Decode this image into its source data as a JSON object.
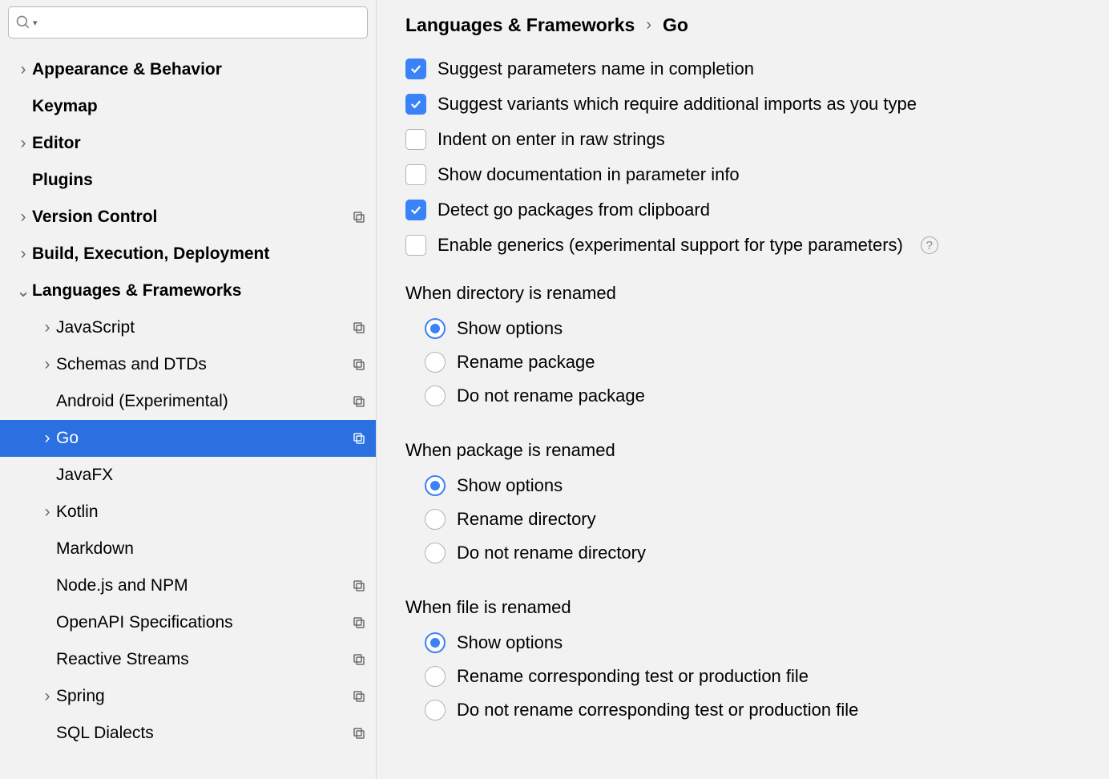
{
  "search": {
    "placeholder": ""
  },
  "sidebar": {
    "items": [
      {
        "label": "Appearance & Behavior",
        "bold": true,
        "depth": 0,
        "chevron": "right",
        "profile": false,
        "selected": false
      },
      {
        "label": "Keymap",
        "bold": true,
        "depth": 0,
        "chevron": "none",
        "profile": false,
        "selected": false
      },
      {
        "label": "Editor",
        "bold": true,
        "depth": 0,
        "chevron": "right",
        "profile": false,
        "selected": false
      },
      {
        "label": "Plugins",
        "bold": true,
        "depth": 0,
        "chevron": "none",
        "profile": false,
        "selected": false
      },
      {
        "label": "Version Control",
        "bold": true,
        "depth": 0,
        "chevron": "right",
        "profile": true,
        "selected": false
      },
      {
        "label": "Build, Execution, Deployment",
        "bold": true,
        "depth": 0,
        "chevron": "right",
        "profile": false,
        "selected": false
      },
      {
        "label": "Languages & Frameworks",
        "bold": true,
        "depth": 0,
        "chevron": "down",
        "profile": false,
        "selected": false
      },
      {
        "label": "JavaScript",
        "bold": false,
        "depth": 1,
        "chevron": "right",
        "profile": true,
        "selected": false
      },
      {
        "label": "Schemas and DTDs",
        "bold": false,
        "depth": 1,
        "chevron": "right",
        "profile": true,
        "selected": false
      },
      {
        "label": "Android (Experimental)",
        "bold": false,
        "depth": 1,
        "chevron": "none",
        "profile": true,
        "selected": false
      },
      {
        "label": "Go",
        "bold": false,
        "depth": 1,
        "chevron": "right",
        "profile": true,
        "selected": true
      },
      {
        "label": "JavaFX",
        "bold": false,
        "depth": 1,
        "chevron": "none",
        "profile": false,
        "selected": false
      },
      {
        "label": "Kotlin",
        "bold": false,
        "depth": 1,
        "chevron": "right",
        "profile": false,
        "selected": false
      },
      {
        "label": "Markdown",
        "bold": false,
        "depth": 1,
        "chevron": "none",
        "profile": false,
        "selected": false
      },
      {
        "label": "Node.js and NPM",
        "bold": false,
        "depth": 1,
        "chevron": "none",
        "profile": true,
        "selected": false
      },
      {
        "label": "OpenAPI Specifications",
        "bold": false,
        "depth": 1,
        "chevron": "none",
        "profile": true,
        "selected": false
      },
      {
        "label": "Reactive Streams",
        "bold": false,
        "depth": 1,
        "chevron": "none",
        "profile": true,
        "selected": false
      },
      {
        "label": "Spring",
        "bold": false,
        "depth": 1,
        "chevron": "right",
        "profile": true,
        "selected": false
      },
      {
        "label": "SQL Dialects",
        "bold": false,
        "depth": 1,
        "chevron": "none",
        "profile": true,
        "selected": false
      }
    ]
  },
  "breadcrumb": {
    "parent": "Languages & Frameworks",
    "current": "Go"
  },
  "checkboxes": [
    {
      "label": "Suggest parameters name in completion",
      "checked": true,
      "help": false
    },
    {
      "label": "Suggest variants which require additional imports as you type",
      "checked": true,
      "help": false
    },
    {
      "label": "Indent on enter in raw strings",
      "checked": false,
      "help": false
    },
    {
      "label": "Show documentation in parameter info",
      "checked": false,
      "help": false
    },
    {
      "label": "Detect go packages from clipboard",
      "checked": true,
      "help": false
    },
    {
      "label": "Enable generics (experimental support for type parameters)",
      "checked": false,
      "help": true
    }
  ],
  "radio_groups": [
    {
      "title": "When directory is renamed",
      "options": [
        {
          "label": "Show options",
          "checked": true
        },
        {
          "label": "Rename package",
          "checked": false
        },
        {
          "label": "Do not rename package",
          "checked": false
        }
      ]
    },
    {
      "title": "When package is renamed",
      "options": [
        {
          "label": "Show options",
          "checked": true
        },
        {
          "label": "Rename directory",
          "checked": false
        },
        {
          "label": "Do not rename directory",
          "checked": false
        }
      ]
    },
    {
      "title": "When file is renamed",
      "options": [
        {
          "label": "Show options",
          "checked": true
        },
        {
          "label": "Rename corresponding test or production file",
          "checked": false
        },
        {
          "label": "Do not rename corresponding test or production file",
          "checked": false
        }
      ]
    }
  ]
}
